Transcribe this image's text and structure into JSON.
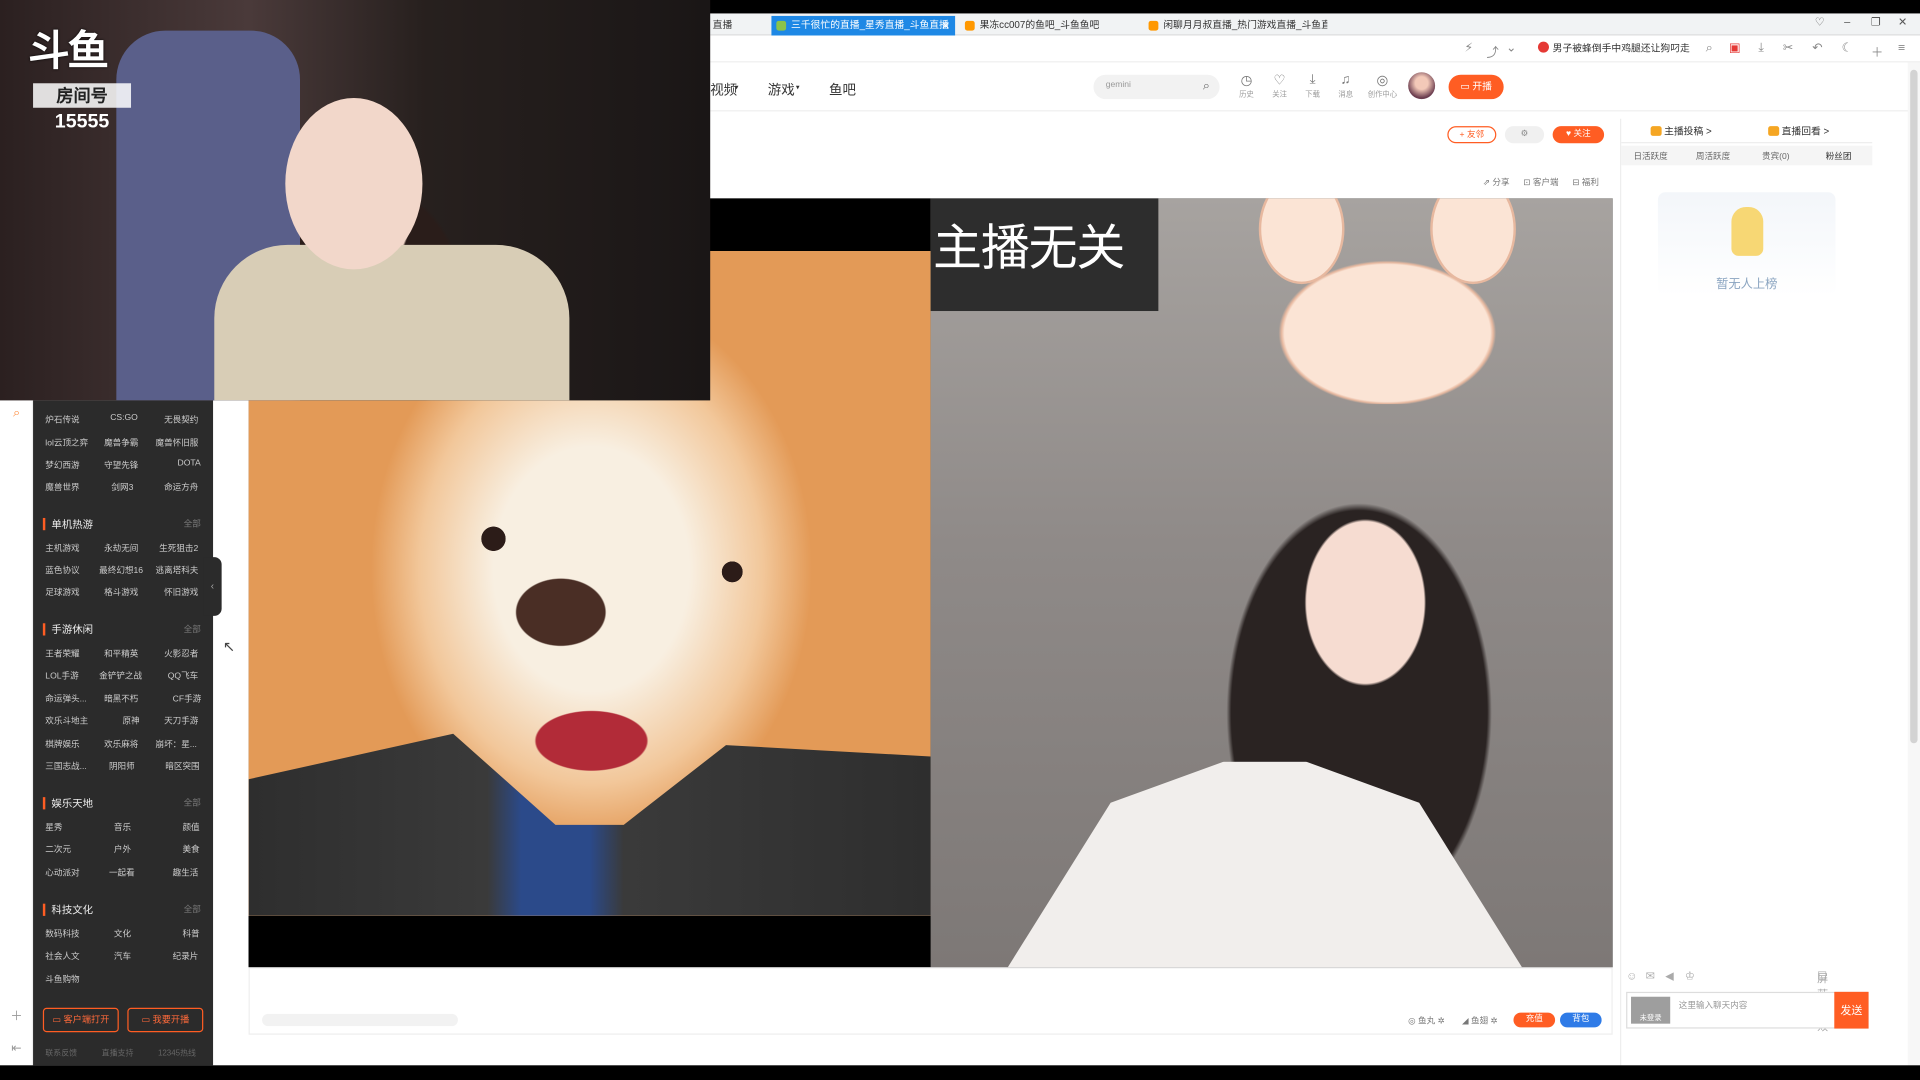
{
  "browser": {
    "tabs": [
      {
        "label": "直播"
      },
      {
        "label": "三千很忙的直播_星秀直播_斗鱼直播"
      },
      {
        "label": "果冻cc007的鱼吧_斗鱼鱼吧"
      },
      {
        "label": "闲聊月月叔直播_热门游戏直播_斗鱼直"
      }
    ],
    "news_ticker": "男子被蜂倒手中鸡腿还让狗叼走",
    "new_tab_icon": "plus-icon"
  },
  "site": {
    "nav": [
      {
        "label": "视频"
      },
      {
        "label": "游戏"
      },
      {
        "label": "鱼吧"
      }
    ],
    "search_placeholder": "gemini",
    "header_icons": [
      {
        "label": "历史",
        "icon": "clock-icon"
      },
      {
        "label": "关注",
        "icon": "heart-icon"
      },
      {
        "label": "下载",
        "icon": "download-icon"
      },
      {
        "label": "消息",
        "icon": "bell-icon"
      },
      {
        "label": "创作中心",
        "icon": "bulb-icon"
      }
    ],
    "kaibo_label": "开播"
  },
  "sidebar": {
    "sections": [
      {
        "title": "",
        "all": "",
        "items": [
          "炉石传说",
          "CS:GO",
          "无畏契约",
          "lol云顶之弈",
          "魔兽争霸",
          "魔兽怀旧服",
          "梦幻西游",
          "守望先锋",
          "DOTA",
          "魔兽世界",
          "剑网3",
          "命运方舟"
        ]
      },
      {
        "title": "单机热游",
        "all": "全部",
        "items": [
          "主机游戏",
          "永劫无间",
          "生死狙击2",
          "蓝色协议",
          "最终幻想16",
          "逃离塔科夫",
          "足球游戏",
          "格斗游戏",
          "怀旧游戏"
        ]
      },
      {
        "title": "手游休闲",
        "all": "全部",
        "items": [
          "王者荣耀",
          "和平精英",
          "火影忍者",
          "LOL手游",
          "金铲铲之战",
          "QQ飞车",
          "命运弹头...",
          "暗黑不朽",
          "CF手游",
          "欢乐斗地主",
          "原神",
          "天刀手游",
          "棋牌娱乐",
          "欢乐麻将",
          "崩坏：星...",
          "三国志战...",
          "阴阳师",
          "暗区突围"
        ]
      },
      {
        "title": "娱乐天地",
        "all": "全部",
        "items": [
          "星秀",
          "音乐",
          "颜值",
          "二次元",
          "户外",
          "美食",
          "心动派对",
          "一起看",
          "趣生活"
        ]
      },
      {
        "title": "科技文化",
        "all": "全部",
        "items": [
          "数码科技",
          "文化",
          "科普",
          "社会人文",
          "汽车",
          "纪录片",
          "斗鱼购物"
        ]
      }
    ],
    "buttons": {
      "client": "客户端打开",
      "start": "我要开播"
    },
    "footer": [
      "联系反馈",
      "直播支持",
      "12345热线"
    ]
  },
  "room": {
    "add_label": "+ 友邻",
    "follow_label": "关注",
    "actions": [
      {
        "label": "分享"
      },
      {
        "label": "客户端"
      },
      {
        "label": "福利"
      }
    ]
  },
  "video": {
    "caption": "主播无关"
  },
  "below": {
    "items": [
      {
        "label": "鱼丸"
      },
      {
        "label": "鱼翅"
      }
    ],
    "recharge": "充值",
    "backpack": "背包"
  },
  "right": {
    "links": [
      {
        "label": "主播投稿 >"
      },
      {
        "label": "直播回看 >"
      }
    ],
    "tabs": [
      "日活跃度",
      "周活跃度",
      "贵宾(0)",
      "粉丝团"
    ],
    "empty_text": "暂无人上榜",
    "shield_label": "屏蔽特效",
    "chat_placeholder": "这里输入聊天内容",
    "chat_avatar": "未登录",
    "send_label": "发送"
  },
  "overlay": {
    "logo_text": "斗鱼",
    "room_tag": "房间号",
    "room_number": "15555"
  },
  "colors": {
    "accent": "#ff5d23",
    "tab_active": "#1e88e5",
    "sidebar_bg": "#2b2b2b"
  }
}
